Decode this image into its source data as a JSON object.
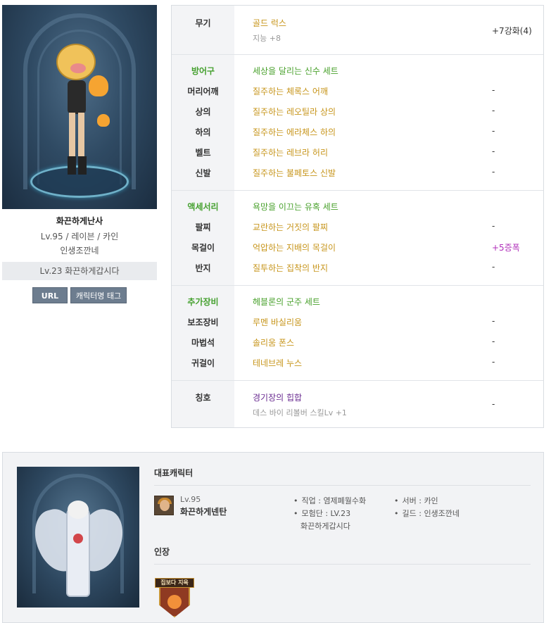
{
  "character": {
    "name": "화끈하게난사",
    "meta": "Lv.95 / 레이븐 / 카인",
    "guild": "인생조깐네",
    "adventure": "Lv.23 화끈하게갑시다",
    "url_button": "URL",
    "tag_button": "캐릭터명 태그"
  },
  "weapon": {
    "slot": "무기",
    "item": "골드 럭스",
    "sub": "지능 +8",
    "value": "+7강화(4)"
  },
  "armor": {
    "category": "방어구",
    "set_name": "세상을 달리는 신수 세트",
    "rows": [
      {
        "slot": "머리어깨",
        "item": "질주하는 체록스 어깨",
        "value": "-"
      },
      {
        "slot": "상의",
        "item": "질주하는 레오틸라 상의",
        "value": "-"
      },
      {
        "slot": "하의",
        "item": "질주하는 에라체스 하의",
        "value": "-"
      },
      {
        "slot": "벨트",
        "item": "질주하는 레브라 허리",
        "value": "-"
      },
      {
        "slot": "신발",
        "item": "질주하는 불페토스 신발",
        "value": "-"
      }
    ]
  },
  "accessory": {
    "category": "액세서리",
    "set_name": "욕망을 이끄는 유혹 세트",
    "rows": [
      {
        "slot": "팔찌",
        "item": "교란하는 거짓의 팔찌",
        "value": "-"
      },
      {
        "slot": "목걸이",
        "item": "억압하는 지배의 목걸이",
        "value": "+5증폭"
      },
      {
        "slot": "반지",
        "item": "질투하는 집착의 반지",
        "value": "-"
      }
    ]
  },
  "extra": {
    "category": "추가장비",
    "set_name": "헤블론의 군주 세트",
    "rows": [
      {
        "slot": "보조장비",
        "item": "루멘 바실리움",
        "value": "-"
      },
      {
        "slot": "마법석",
        "item": "솔리움 폰스",
        "value": "-"
      },
      {
        "slot": "귀걸이",
        "item": "테네브레 누스",
        "value": "-"
      }
    ]
  },
  "title_row": {
    "slot": "칭호",
    "item": "경기장의 힙합",
    "sub": "데스 바이 리볼버 스킬Lv +1",
    "value": "-"
  },
  "representative": {
    "heading": "대표캐릭터",
    "level": "Lv.95",
    "name": "화끈하게넨탄",
    "job": "직업 : 염제폐월수화",
    "adventure": "모험단 : LV.23",
    "adventure_name": "화끈하게갑시다",
    "server": "서버 : 카인",
    "guild": "길드 : 인생조깐네",
    "emblem_heading": "인장",
    "emblem_text": "집보다 지옥"
  },
  "colors": {
    "item_gold": "#c7951b",
    "set_green": "#49a12c",
    "title_purple": "#6a2c91",
    "amplify_purple": "#b02fba",
    "button_gray": "#6d7d8f"
  }
}
